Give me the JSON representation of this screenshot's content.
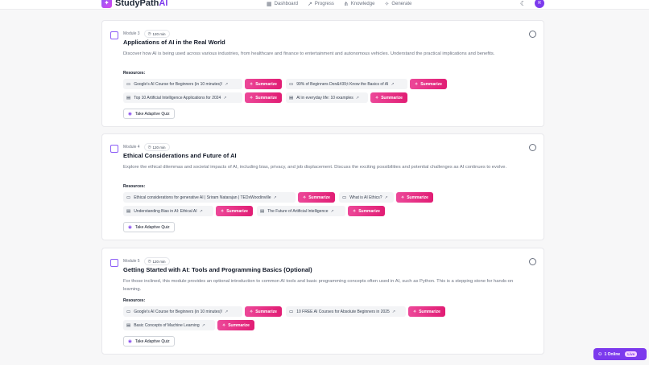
{
  "header": {
    "brand_main": "StudyPath",
    "brand_accent": "AI",
    "nav": [
      {
        "label": "Dashboard",
        "icon": "grid-icon"
      },
      {
        "label": "Progress",
        "icon": "trend-icon"
      },
      {
        "label": "Knowledge",
        "icon": "network-icon"
      },
      {
        "label": "Generate",
        "icon": "sparkles-icon"
      }
    ],
    "avatar_initial": "R"
  },
  "modules": [
    {
      "module_label": "Module 3",
      "duration": "120 min",
      "title": "Applications of AI in the Real World",
      "description": "Discover how AI is being used across various industries, from healthcare and finance to entertainment and autonomous vehicles. Understand the practical implications and benefits.",
      "resources_label": "Resources:",
      "resources": [
        {
          "type": "video",
          "label": "Google's AI Course for Beginners (in 10 minutes)!",
          "summarize": "Summarize"
        },
        {
          "type": "video",
          "label": "99% of Beginners Don&#39;t Know the Basics of AI",
          "summarize": "Summarize"
        },
        {
          "type": "doc",
          "label": "Top 10 Artificial Intelligence Applications for 2024",
          "summarize": "Summarize"
        },
        {
          "type": "doc",
          "label": "AI in everyday life: 10 examples",
          "summarize": "Summarize"
        }
      ],
      "quiz_label": "Take Adaptive Quiz"
    },
    {
      "module_label": "Module 4",
      "duration": "120 min",
      "title": "Ethical Considerations and Future of AI",
      "description": "Explore the ethical dilemmas and societal impacts of AI, including bias, privacy, and job displacement. Discuss the exciting possibilities and potential challenges as AI continues to evolve.",
      "resources_label": "Resources:",
      "resources": [
        {
          "type": "video",
          "label": "Ethical considerations for generative AI | Sriram Natarajan | TEDxWoodinville",
          "summarize": "Summarize"
        },
        {
          "type": "video",
          "label": "What is AI Ethics?",
          "summarize": "Summarize"
        },
        {
          "type": "doc",
          "label": "Understanding Bias in AI: Ethical AI",
          "summarize": "Summarize"
        },
        {
          "type": "doc",
          "label": "The Future of Artificial Intelligence",
          "summarize": "Summarize"
        }
      ],
      "quiz_label": "Take Adaptive Quiz"
    },
    {
      "module_label": "Module 5",
      "duration": "120 min",
      "title": "Getting Started with AI: Tools and Programming Basics (Optional)",
      "description": "For those inclined, this module provides an optional introduction to common AI tools and basic programming concepts often used in AI, such as Python. This is a stepping stone for hands-on learning.",
      "resources_label": "Resources:",
      "resources": [
        {
          "type": "video",
          "label": "Google's AI Course for Beginners (in 10 minutes)!",
          "summarize": "Summarize"
        },
        {
          "type": "video",
          "label": "10 FREE AI Courses for Absolute Beginners in 2025",
          "summarize": "Summarize"
        },
        {
          "type": "doc",
          "label": "Basic Concepts of Machine Learning",
          "summarize": "Summarize"
        }
      ],
      "quiz_label": "Take Adaptive Quiz"
    }
  ],
  "online_badge": {
    "label": "1 Online",
    "live": "Live"
  }
}
